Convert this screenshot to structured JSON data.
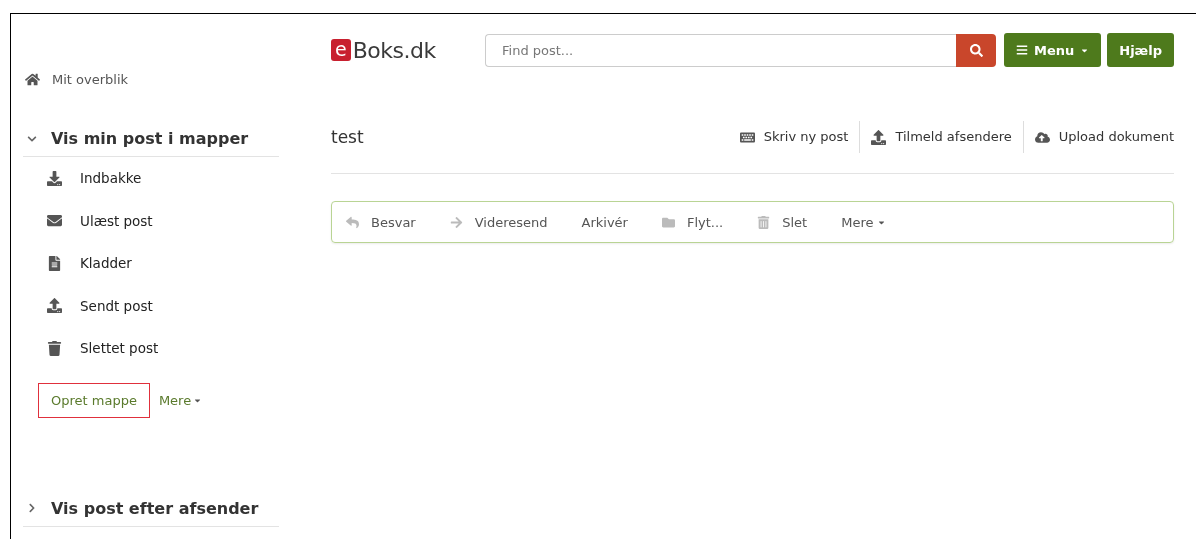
{
  "sidebar": {
    "overview": "Mit overblik",
    "sections": [
      {
        "title": "Vis min post i mapper",
        "expanded": true,
        "folders": [
          "Indbakke",
          "Ulæst post",
          "Kladder",
          "Sendt post",
          "Slettet post"
        ],
        "create_button": {
          "label": "Opret mappe",
          "highlighted": true
        },
        "more": "Mere"
      },
      {
        "title": "Vis post efter afsender",
        "expanded": false
      }
    ]
  },
  "header": {
    "logo_badge": "e",
    "logo_text": "Boks.dk",
    "search": {
      "placeholder": "Find post..."
    },
    "menu_button": "Menu",
    "help_button": "Hjælp"
  },
  "folder_title": "test",
  "actions": [
    "Skriv ny post",
    "Tilmeld afsendere",
    "Upload dokument"
  ],
  "toolbar": [
    {
      "label": "Besvar",
      "kind": "reply"
    },
    {
      "label": "Videresend",
      "kind": "forward"
    },
    {
      "label": "Arkivér",
      "kind": "plain"
    },
    {
      "label": "Flyt...",
      "kind": "move"
    },
    {
      "label": "Slet",
      "kind": "delete"
    },
    {
      "label": "Mere",
      "kind": "more"
    }
  ]
}
